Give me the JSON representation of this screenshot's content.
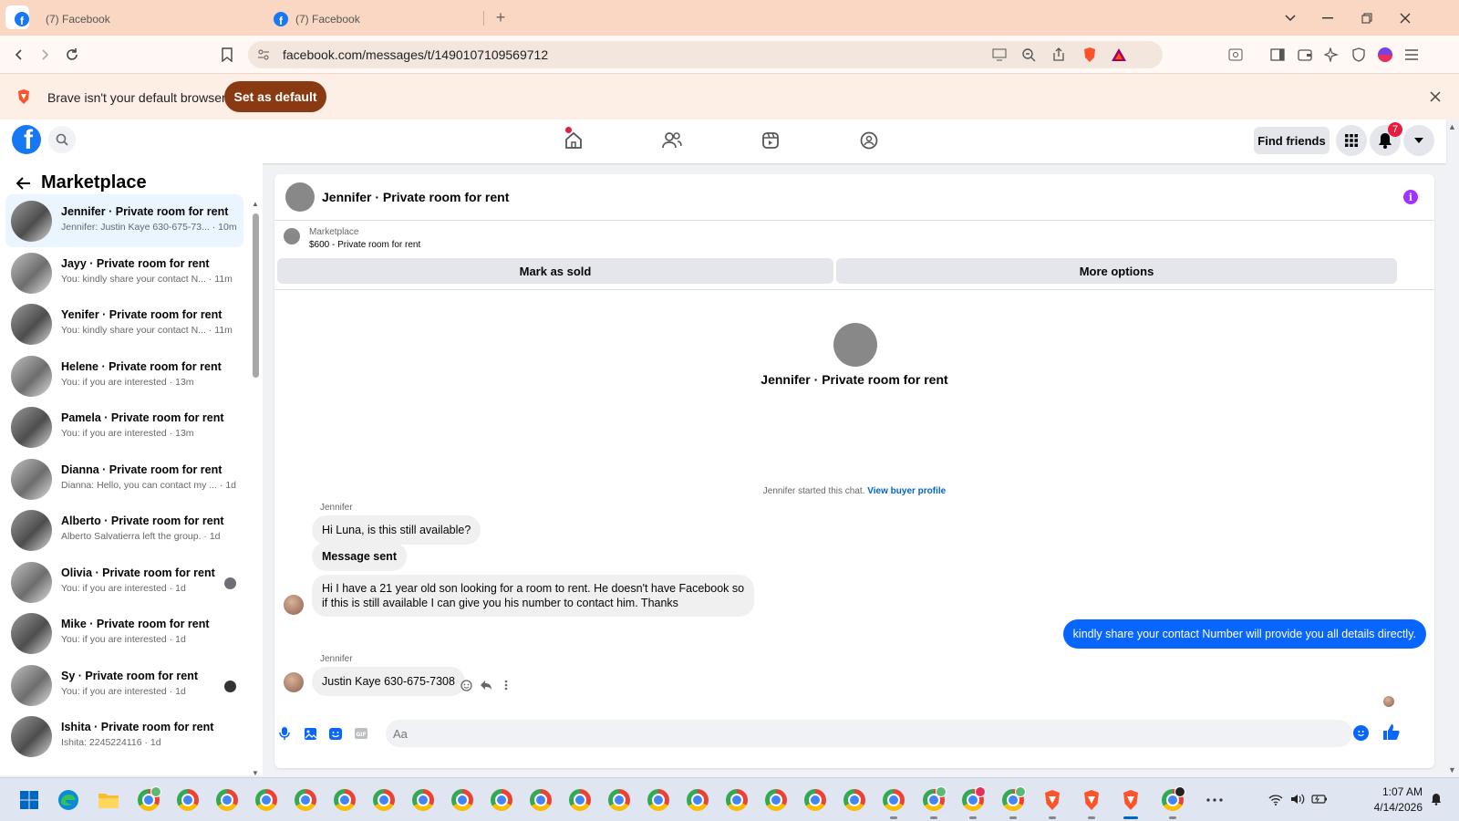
{
  "browser": {
    "tabs": [
      {
        "label": "(7) Facebook",
        "active": true
      },
      {
        "label": "(7) Facebook",
        "active": false
      }
    ],
    "url": "facebook.com/messages/t/1490107109569712",
    "infobar": {
      "message": "Brave isn't your default browser",
      "button": "Set as default"
    }
  },
  "fb_header": {
    "find_friends": "Find friends",
    "notifications_count": "7"
  },
  "sidebar": {
    "title": "Marketplace",
    "conversations": [
      {
        "name": "Jennifer · Private room for rent",
        "preview": "Jennifer: Justin Kaye 630-675-73... · 10m",
        "active": true
      },
      {
        "name": "Jayy · Private room for rent",
        "preview": "You: kindly share your contact N... · 11m"
      },
      {
        "name": "Yenifer · Private room for rent",
        "preview": "You: kindly share your contact N... · 11m"
      },
      {
        "name": "Helene · Private room for rent",
        "preview": "You: if you are interested · 13m"
      },
      {
        "name": "Pamela · Private room for rent",
        "preview": "You: if you are interested · 13m"
      },
      {
        "name": "Dianna · Private room for rent",
        "preview": "Dianna: Hello, you can contact my ... · 1d"
      },
      {
        "name": "Alberto · Private room for rent",
        "preview": "Alberto Salvatierra left the group. · 1d"
      },
      {
        "name": "Olivia · Private room for rent",
        "preview": "You: if you are interested · 1d"
      },
      {
        "name": "Mike · Private room for rent",
        "preview": "You: if you are interested · 1d"
      },
      {
        "name": "Sy · Private room for rent",
        "preview": "You: if you are interested · 1d"
      },
      {
        "name": "Ishita · Private room for rent",
        "preview": "Ishita: 2245224116 · 1d"
      }
    ]
  },
  "chat": {
    "title": "Jennifer · Private room for rent",
    "marketplace_label": "Marketplace",
    "listing": "$600 - Private room for rent",
    "mark_sold": "Mark as sold",
    "more_options": "More options",
    "intro_name": "Jennifer · Private room for rent",
    "started_text": "Jennifer started this chat.",
    "view_buyer": "View buyer profile",
    "messages": [
      {
        "sender": "Jennifer",
        "text": "Hi Luna, is this still available?"
      },
      {
        "text": "Message sent"
      },
      {
        "text_line1": "Hi I have a 21 year old son looking for a room to rent. He doesn't have Facebook so",
        "text_line2": "if this is still available I can give you his number to contact him. Thanks"
      },
      {
        "text": "kindly share your contact Number will provide you all details directly.",
        "outgoing": true
      },
      {
        "sender": "Jennifer",
        "text": "Justin Kaye 630-675-7308"
      }
    ],
    "composer_placeholder": "Aa"
  },
  "taskbar": {
    "time": "1:07 AM",
    "date": "4/14/2026"
  },
  "colors": {
    "fb_blue": "#1877f2",
    "messenger_blue": "#0866ff",
    "brave_button": "#8a3a12",
    "tabstrip": "#f9d7c3"
  }
}
